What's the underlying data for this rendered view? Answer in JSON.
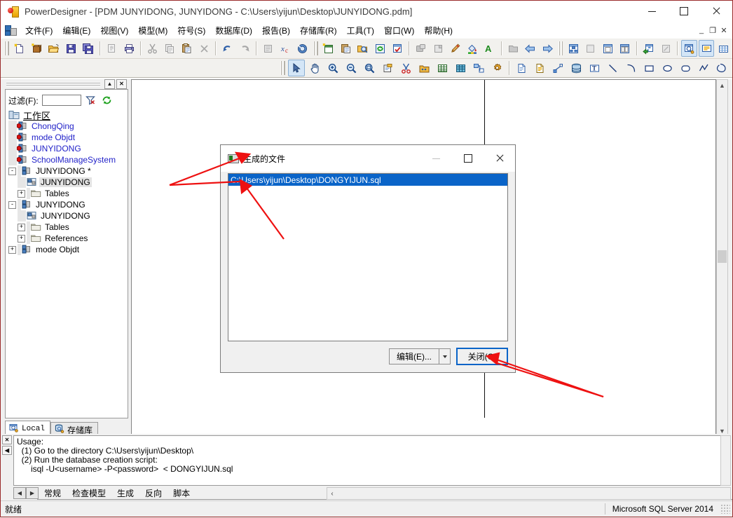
{
  "window": {
    "title": "PowerDesigner - [PDM JUNYIDONG, JUNYIDONG - C:\\Users\\yijun\\Desktop\\JUNYIDONG.pdm]",
    "app_icon": "powerdesigner-icon",
    "minimize": "minimize-icon",
    "maximize": "maximize-icon",
    "close": "close-icon"
  },
  "menu": {
    "mdi_icon": "mdi-document-icon",
    "items": [
      {
        "label": "文件(F)",
        "name": "menu-file"
      },
      {
        "label": "编辑(E)",
        "name": "menu-edit"
      },
      {
        "label": "视图(V)",
        "name": "menu-view"
      },
      {
        "label": "模型(M)",
        "name": "menu-model"
      },
      {
        "label": "符号(S)",
        "name": "menu-symbol"
      },
      {
        "label": "数据库(D)",
        "name": "menu-database"
      },
      {
        "label": "报告(B)",
        "name": "menu-report"
      },
      {
        "label": "存储库(R)",
        "name": "menu-repository"
      },
      {
        "label": "工具(T)",
        "name": "menu-tools"
      },
      {
        "label": "窗口(W)",
        "name": "menu-window"
      },
      {
        "label": "帮助(H)",
        "name": "menu-help"
      }
    ],
    "mdi_buttons": [
      {
        "label": "_",
        "name": "mdi-minimize-button"
      },
      {
        "label": "❐",
        "name": "mdi-restore-button"
      },
      {
        "label": "✕",
        "name": "mdi-close-button"
      }
    ]
  },
  "browser": {
    "collapse_icon": "collapse-icon",
    "close_icon": "panel-close-icon",
    "filter_label": "过滤(F):",
    "filter_value": "",
    "filter_clear_icon": "clear-filter-icon",
    "filter_refresh_icon": "refresh-icon",
    "tree": [
      {
        "label": "工作区",
        "depth": 0,
        "icon": "workspace-icon",
        "expander": "",
        "color": "black",
        "underline": true
      },
      {
        "label": "ChongQing",
        "depth": 1,
        "icon": "model-unsaved-icon",
        "expander": "",
        "color": "blue"
      },
      {
        "label": "mode Objdt",
        "depth": 1,
        "icon": "model-unsaved-icon",
        "expander": "",
        "color": "blue"
      },
      {
        "label": "JUNYIDONG",
        "depth": 1,
        "icon": "model-unsaved-icon",
        "expander": "",
        "color": "blue"
      },
      {
        "label": "SchoolManageSystem",
        "depth": 1,
        "icon": "model-unsaved-icon",
        "expander": "",
        "color": "blue"
      },
      {
        "label": "JUNYIDONG *",
        "depth": 1,
        "icon": "model-icon",
        "expander": "-",
        "color": "black"
      },
      {
        "label": "JUNYIDONG",
        "depth": 2,
        "icon": "diagram-icon",
        "expander": "",
        "color": "black",
        "selected": true
      },
      {
        "label": "Tables",
        "depth": 2,
        "icon": "folder-icon",
        "expander": "+",
        "color": "black"
      },
      {
        "label": "JUNYIDONG",
        "depth": 1,
        "icon": "model-icon",
        "expander": "-",
        "color": "black"
      },
      {
        "label": "JUNYIDONG",
        "depth": 2,
        "icon": "diagram-icon",
        "expander": "",
        "color": "black"
      },
      {
        "label": "Tables",
        "depth": 2,
        "icon": "folder-icon",
        "expander": "+",
        "color": "black"
      },
      {
        "label": "References",
        "depth": 2,
        "icon": "folder-icon",
        "expander": "+",
        "color": "black"
      },
      {
        "label": "mode Objdt",
        "depth": 1,
        "icon": "model-icon",
        "expander": "+",
        "color": "black"
      }
    ],
    "tabs": [
      {
        "label": "Local",
        "name": "tab-local",
        "icon": "local-icon",
        "active": true,
        "mono": true
      },
      {
        "label": "存储库",
        "name": "tab-repository",
        "icon": "repository-icon",
        "active": false,
        "mono": false
      }
    ]
  },
  "dialog": {
    "title": "生成的文件",
    "icon": "generated-files-icon",
    "minimize": "minimize-icon",
    "maximize": "maximize-icon",
    "close": "close-icon",
    "minimize_disabled": true,
    "files": [
      {
        "path": "C:\\Users\\yijun\\Desktop\\DONGYIJUN.sql",
        "selected": true
      }
    ],
    "edit_button": "编辑(E)...",
    "edit_dropdown_icon": "chevron-down-icon",
    "close_button": "关闭(C)"
  },
  "output": {
    "close_icon": "close-icon",
    "collapse_icon": "collapse-icon",
    "text": "Usage:\n  (1) Go to the directory C:\\Users\\yijun\\Desktop\\\n  (2) Run the database creation script:\n      isql -U<username> -P<password>  < DONGYIJUN.sql",
    "prev_icon": "prev-tab-icon",
    "next_icon": "next-tab-icon",
    "tabs": [
      {
        "label": "常规",
        "name": "output-tab-general",
        "active": false
      },
      {
        "label": "检查模型",
        "name": "output-tab-check-model",
        "active": false
      },
      {
        "label": "生成",
        "name": "output-tab-generate",
        "active": true
      },
      {
        "label": "反向",
        "name": "output-tab-reverse",
        "active": false
      },
      {
        "label": "脚本",
        "name": "output-tab-script",
        "active": false
      }
    ],
    "hscroll_left_icon": "scroll-left-icon"
  },
  "statusbar": {
    "message": "就绪",
    "dbms": "Microsoft SQL Server 2014",
    "resize_grip": "resize-grip-icon"
  },
  "toolbars": {
    "main": [
      {
        "name": "new-button",
        "icon": "new-doc-icon"
      },
      {
        "name": "new-model-button",
        "icon": "new-model-icon"
      },
      {
        "name": "open-button",
        "icon": "open-folder-icon"
      },
      {
        "name": "save-button",
        "icon": "save-icon"
      },
      {
        "name": "save-all-button",
        "icon": "save-all-icon"
      },
      {
        "name": "print-preview-button",
        "icon": "print-preview-icon",
        "disabled": true
      },
      {
        "name": "print-button",
        "icon": "printer-icon"
      },
      {
        "name": "cut-button",
        "icon": "scissors-icon",
        "disabled": true
      },
      {
        "name": "copy-button",
        "icon": "copy-icon",
        "disabled": true
      },
      {
        "name": "paste-button",
        "icon": "paste-icon"
      },
      {
        "name": "delete-button",
        "icon": "delete-x-icon",
        "disabled": true
      },
      {
        "name": "undo-button",
        "icon": "undo-arrow-icon"
      },
      {
        "name": "redo-button",
        "icon": "redo-arrow-icon",
        "disabled": true
      },
      {
        "name": "properties-button",
        "icon": "properties-icon",
        "disabled": true
      },
      {
        "name": "check-model-button",
        "icon": "check-model-icon"
      },
      {
        "name": "help-button",
        "icon": "help-icon"
      },
      {
        "name": "new-diagram-button",
        "icon": "new-diagram-icon"
      },
      {
        "name": "list-button",
        "icon": "list-icon"
      },
      {
        "name": "find-button",
        "icon": "find-objects-icon"
      },
      {
        "name": "refresh-button",
        "icon": "refresh-icon"
      },
      {
        "name": "validate-button",
        "icon": "validate-icon"
      },
      {
        "name": "align-button",
        "icon": "align-icon",
        "disabled": true
      },
      {
        "name": "resize-button",
        "icon": "resize-icon",
        "disabled": true
      },
      {
        "name": "format-brush-button",
        "icon": "paintbrush-icon"
      },
      {
        "name": "fill-color-button",
        "icon": "fill-color-icon"
      },
      {
        "name": "font-color-button",
        "icon": "font-color-icon"
      },
      {
        "name": "folder-button",
        "icon": "grey-folder-icon",
        "disabled": true
      },
      {
        "name": "back-button",
        "icon": "back-arrow-icon"
      },
      {
        "name": "forward-button",
        "icon": "forward-arrow-icon"
      },
      {
        "name": "browser-toggle-button",
        "icon": "browser-window-icon"
      },
      {
        "name": "result-list-button",
        "icon": "result-list-icon",
        "disabled": true
      },
      {
        "name": "tile-window-button",
        "icon": "tile-window-icon"
      },
      {
        "name": "cascade-window-button",
        "icon": "cascade-window-icon"
      },
      {
        "name": "generate-button",
        "icon": "generate-icon"
      },
      {
        "name": "reverse-button",
        "icon": "reverse-icon",
        "disabled": true
      },
      {
        "name": "toggle-browser-button",
        "icon": "toggle-browser-icon",
        "active": true
      },
      {
        "name": "toggle-output-button",
        "icon": "toggle-output-icon",
        "active": true
      },
      {
        "name": "toggle-grid-button",
        "icon": "toggle-grid-icon"
      }
    ],
    "palette": [
      {
        "name": "pointer-tool",
        "icon": "arrow-pointer-icon",
        "active": true
      },
      {
        "name": "pan-tool",
        "icon": "hand-icon"
      },
      {
        "name": "zoom-in-tool",
        "icon": "zoom-in-icon"
      },
      {
        "name": "zoom-out-tool",
        "icon": "zoom-out-icon"
      },
      {
        "name": "zoom-fit-tool",
        "icon": "zoom-fit-icon"
      },
      {
        "name": "properties-tool",
        "icon": "properties-note-icon"
      },
      {
        "name": "delete-tool",
        "icon": "scissors-red-icon"
      },
      {
        "name": "package-tool",
        "icon": "package-icon"
      },
      {
        "name": "table-tool",
        "icon": "table-icon"
      },
      {
        "name": "view-tool",
        "icon": "view-table-icon"
      },
      {
        "name": "reference-tool",
        "icon": "reference-link-icon"
      },
      {
        "name": "procedure-tool",
        "icon": "gear-icon"
      },
      {
        "name": "file-tool",
        "icon": "file-icon"
      },
      {
        "name": "note-tool",
        "icon": "note-icon"
      },
      {
        "name": "link-tool",
        "icon": "dot-link-icon"
      },
      {
        "name": "database-tool",
        "icon": "database-icon"
      },
      {
        "name": "text-tool",
        "icon": "text-box-icon"
      },
      {
        "name": "line-tool",
        "icon": "line-icon"
      },
      {
        "name": "arc-tool",
        "icon": "arc-icon"
      },
      {
        "name": "rectangle-tool",
        "icon": "rectangle-icon"
      },
      {
        "name": "ellipse-tool",
        "icon": "ellipse-icon"
      },
      {
        "name": "rounded-rect-tool",
        "icon": "rounded-rect-icon"
      },
      {
        "name": "polyline-tool",
        "icon": "polyline-icon"
      },
      {
        "name": "polygon-tool",
        "icon": "polygon-icon"
      }
    ]
  },
  "annotations": {
    "color": "#ee1111",
    "arrows": [
      {
        "name": "arrow-to-dialog-title"
      },
      {
        "name": "arrow-to-file-path"
      },
      {
        "name": "arrow-to-close-button"
      }
    ]
  }
}
